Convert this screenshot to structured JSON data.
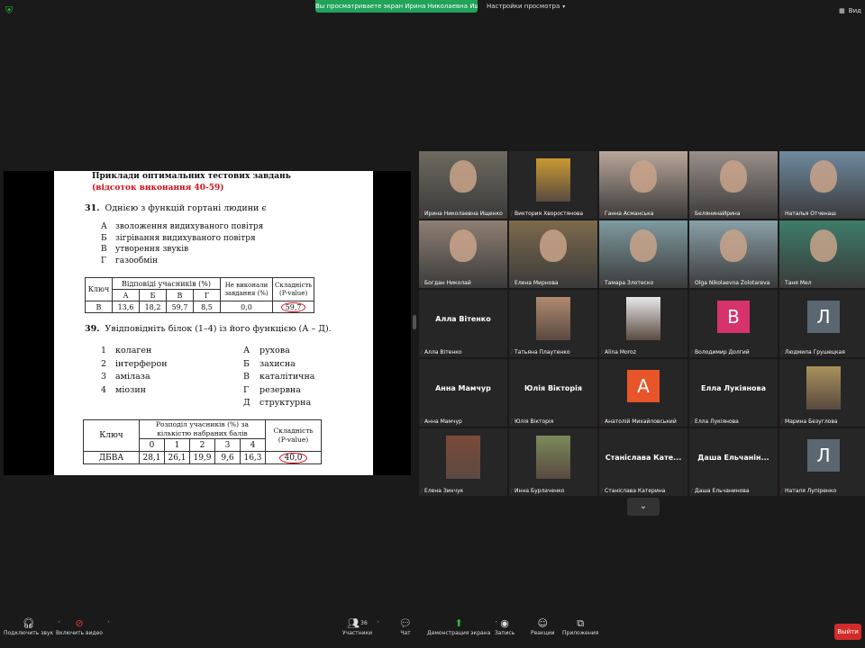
{
  "banner": {
    "sharing_text": "Вы просматриваете экран Ирина Николаевна Ищенко",
    "view_settings": "Настройки просмотра",
    "top_right": "Вид"
  },
  "slide": {
    "title": "Приклади оптимальних тестових завдань",
    "subtitle": "(відсоток виконання 40-59)",
    "q31": {
      "number": "31.",
      "text": "Однією з функцій гортані людини є",
      "options": [
        {
          "key": "А",
          "text": "зволоження видихуваного повітря"
        },
        {
          "key": "Б",
          "text": "зігрівання видихуваного повітря"
        },
        {
          "key": "В",
          "text": "утворення звуків"
        },
        {
          "key": "Г",
          "text": "газообмін"
        }
      ],
      "table": {
        "key_header": "Ключ",
        "answers_header": "Відповіді учасників (%)",
        "not_done_header": "Не виконали завдання (%)",
        "difficulty_header": "Складність (P-value)",
        "answer_cols": [
          "А",
          "Б",
          "В",
          "Г"
        ],
        "row": {
          "key": "В",
          "values": [
            "13,6",
            "18,2",
            "59,7",
            "8,5"
          ],
          "not_done": "0,0",
          "difficulty": "59,7"
        }
      }
    },
    "q39": {
      "number": "39.",
      "text": "Увідповідніть білок (1–4) із його функцією (А – Д).",
      "left": [
        {
          "key": "1",
          "text": "колаген"
        },
        {
          "key": "2",
          "text": "інтерферон"
        },
        {
          "key": "3",
          "text": "амілаза"
        },
        {
          "key": "4",
          "text": "міозин"
        }
      ],
      "right": [
        {
          "key": "А",
          "text": "рухова"
        },
        {
          "key": "Б",
          "text": "захисна"
        },
        {
          "key": "В",
          "text": "каталітична"
        },
        {
          "key": "Г",
          "text": "резервна"
        },
        {
          "key": "Д",
          "text": "структурна"
        }
      ],
      "table": {
        "key_header": "Ключ",
        "dist_header": "Розподіл учасників (%) за кількістю набраних балів",
        "difficulty_header": "Складність (P-value)",
        "score_cols": [
          "0",
          "1",
          "2",
          "3",
          "4"
        ],
        "row": {
          "key": "ДБВА",
          "values": [
            "28,1",
            "26,1",
            "19,9",
            "9,6",
            "16,3"
          ],
          "difficulty": "40,0"
        }
      }
    }
  },
  "participants": [
    {
      "name": "Ирина Николаевна Ищенко",
      "kind": "video",
      "color": "#6d6a5e"
    },
    {
      "name": "Виктория Хворостянова",
      "kind": "photo",
      "color": "#c99a33"
    },
    {
      "name": "Ганна Асманська",
      "kind": "video",
      "color": "#b9a69a"
    },
    {
      "name": "БелянинаИрина",
      "kind": "video",
      "color": "#9a8f8a"
    },
    {
      "name": "Наталья Отченаш",
      "kind": "video",
      "color": "#6f8aa1"
    },
    {
      "name": "Богдан Николай",
      "kind": "video",
      "color": "#8f7f73"
    },
    {
      "name": "Елена Мирнова",
      "kind": "video",
      "color": "#7d6a4c"
    },
    {
      "name": "Тамара Злотеско",
      "kind": "video",
      "color": "#7e9aa0"
    },
    {
      "name": "Olga Nikolaevna Zolotareva",
      "kind": "video",
      "color": "#8aa0a8"
    },
    {
      "name": "Таня Мел",
      "kind": "video",
      "color": "#3e7d6a"
    },
    {
      "name": "Алла Вітенко",
      "kind": "text",
      "big": "Алла Вітенко"
    },
    {
      "name": "Татьяна Плаутенко",
      "kind": "photo",
      "color": "#b08a70"
    },
    {
      "name": "Alina Moroz",
      "kind": "photo",
      "color": "#e8e8e8"
    },
    {
      "name": "Володимир Долгий",
      "kind": "letter",
      "letter": "В",
      "color": "#d6336c"
    },
    {
      "name": "Людмила Грушецкая",
      "kind": "letter",
      "letter": "Л",
      "color": "#5a6670"
    },
    {
      "name": "Анна Мамчур",
      "kind": "text",
      "big": "Анна Мамчур"
    },
    {
      "name": "Юлія Вікторія",
      "kind": "text",
      "big": "Юлія Вікторія"
    },
    {
      "name": "Анатолій Михайловський",
      "kind": "letter",
      "letter": "А",
      "color": "#e8552a"
    },
    {
      "name": "Елла Лукіянова",
      "kind": "text",
      "big": "Елла Лукіянова"
    },
    {
      "name": "Марина Безуглова",
      "kind": "photo",
      "color": "#a8925a"
    },
    {
      "name": "Елена Зинчук",
      "kind": "photo",
      "color": "#7a4a3a"
    },
    {
      "name": "Инна Бурлаченко",
      "kind": "photo",
      "color": "#7a8a5a"
    },
    {
      "name": "Станіслава Катерина",
      "kind": "text",
      "big": "Станіслава Кате..."
    },
    {
      "name": "Даша Ельчанинова",
      "kind": "text",
      "big": "Даша Ельчанін..."
    },
    {
      "name": "Наталя Лупіренко",
      "kind": "letter",
      "letter": "Л",
      "color": "#5a6670"
    }
  ],
  "toolbar": {
    "audio": "Подключить звук",
    "video": "Включить видео",
    "participants": "Участники",
    "participants_count": "36",
    "chat": "Чат",
    "share": "Демонстрация экрана",
    "record": "Запись",
    "reactions": "Реакции",
    "apps": "Приложения",
    "leave": "Выйти"
  },
  "colors": {
    "share_banner": "#21a35a",
    "leave_button": "#d12b2b",
    "active_speaker": "#c6d95a",
    "muted_mic": "#e23a3a",
    "slide_accent": "#d0121b"
  }
}
